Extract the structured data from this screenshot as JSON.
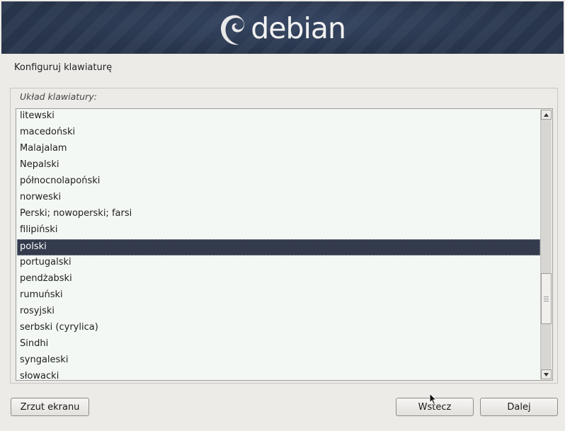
{
  "banner": {
    "logo_text": "debian"
  },
  "page": {
    "title": "Konfiguruj klawiaturę"
  },
  "group": {
    "label": "Układ klawiatury:"
  },
  "list": {
    "items": [
      "litewski",
      "macedoński",
      "Malajalam",
      "Nepalski",
      "północnolapoński",
      "norweski",
      "Perski; nowoperski; farsi",
      "filipiński",
      "polski",
      "portugalski",
      "pendżabski",
      "rumuński",
      "rosyjski",
      "serbski (cyrylica)",
      "Sindhi",
      "syngaleski",
      "słowacki"
    ],
    "selected": "polski"
  },
  "scrollbar": {
    "up_icon": "triangle-up-icon",
    "down_icon": "triangle-down-icon",
    "position_fraction": 0.65
  },
  "buttons": {
    "screenshot": "Zrzut ekranu",
    "back": "Wstecz",
    "next": "Dalej"
  },
  "colors": {
    "banner": "#27344a",
    "selection": "#333b4c",
    "list_background": "#f4f8f4",
    "window_background": "#edebe8"
  }
}
